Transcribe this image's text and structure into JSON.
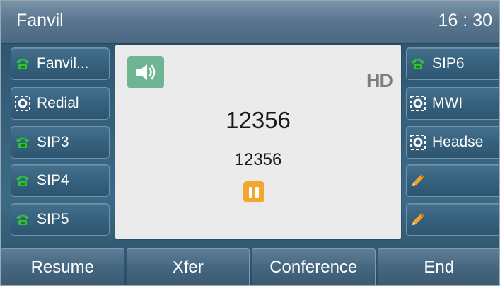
{
  "statusbar": {
    "brand": "Fanvil",
    "time": "16 : 30"
  },
  "line_keys_left": [
    {
      "label": "Fanvil...",
      "icon": "phone-green-icon"
    },
    {
      "label": "Redial",
      "icon": "blf-ring-icon"
    },
    {
      "label": "SIP3",
      "icon": "phone-green-icon"
    },
    {
      "label": "SIP4",
      "icon": "phone-green-icon"
    },
    {
      "label": "SIP5",
      "icon": "phone-green-icon"
    }
  ],
  "line_keys_right": [
    {
      "label": "SIP6",
      "icon": "phone-green-icon"
    },
    {
      "label": "MWI",
      "icon": "blf-ring-icon"
    },
    {
      "label": "Headse",
      "icon": "blf-ring-icon"
    },
    {
      "label": "",
      "icon": "pencil-edit-icon"
    },
    {
      "label": "",
      "icon": "pencil-edit-icon"
    }
  ],
  "call": {
    "quality_badge": "HD",
    "number": "12356",
    "name": "12356",
    "audio_icon": "speaker-icon",
    "status_icon": "hold-pause-icon"
  },
  "softkeys": [
    "Resume",
    "Xfer",
    "Conference",
    "End"
  ],
  "colors": {
    "speaker_badge": "#6eb593",
    "hold_badge": "#f2a72e",
    "phone_icon": "#2fbf3c",
    "pencil_icon": "#f0a531"
  }
}
